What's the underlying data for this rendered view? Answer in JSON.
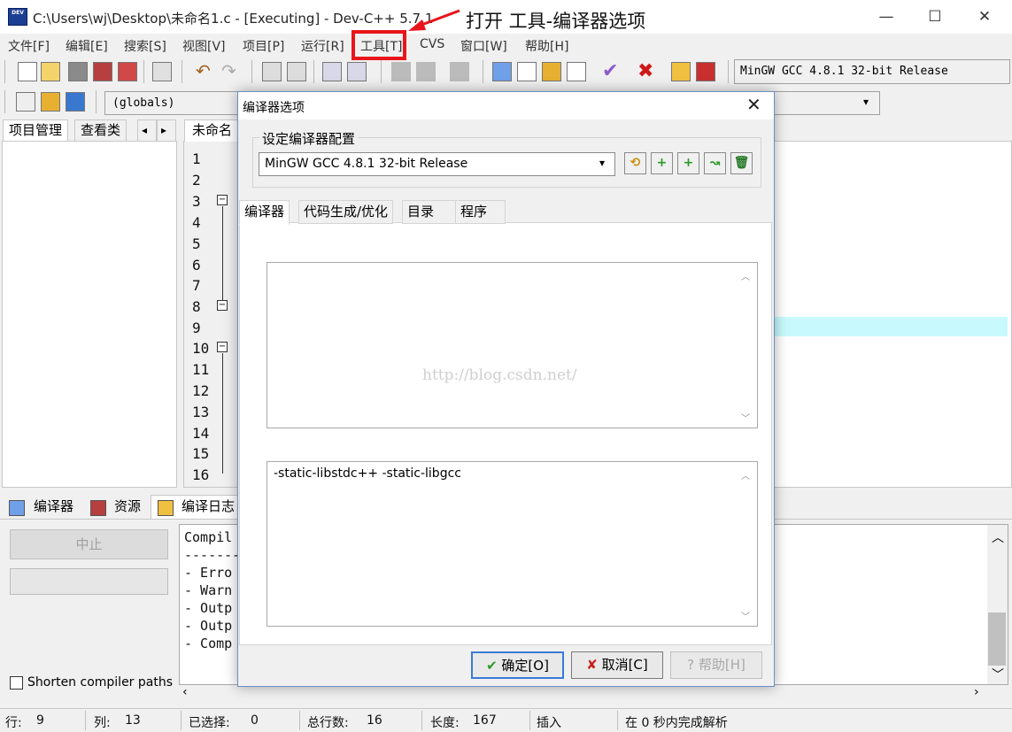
{
  "window": {
    "title": "C:\\Users\\wj\\Desktop\\未命名1.c - [Executing] - Dev-C++ 5.7.1",
    "app_icon_label": "DEV",
    "minimize": "—",
    "maximize": "☐",
    "close": "✕"
  },
  "annotation": {
    "text": "打开 工具-编译器选项",
    "color": "#e8151b"
  },
  "menu": [
    "文件[F]",
    "编辑[E]",
    "搜索[S]",
    "视图[V]",
    "项目[P]",
    "运行[R]",
    "工具[T]",
    "CVS",
    "窗口[W]",
    "帮助[H]"
  ],
  "toolbar": {
    "compiler_profile": "MinGW GCC 4.8.1 32-bit Release",
    "scope_select": "(globals)"
  },
  "left_panel": {
    "tabs": [
      "项目管理",
      "查看类"
    ],
    "nav_prev": "◂",
    "nav_next": "▸"
  },
  "editor": {
    "tab": "未命名1",
    "line_numbers": [
      "1",
      "2",
      "3",
      "4",
      "5",
      "6",
      "7",
      "8",
      "9",
      "10",
      "11",
      "12",
      "13",
      "14",
      "15",
      "16"
    ],
    "fold_open": "⊟"
  },
  "bottom_panel": {
    "tabs": [
      "编译器",
      "资源",
      "编译日志"
    ],
    "stop_button": "中止",
    "shorten_paths": "Shorten compiler paths",
    "shorten_paths_checked": false,
    "log_lines": [
      "Compil",
      "-------",
      "- Erro",
      "- Warn",
      "- Outp",
      "- Outp",
      "- Comp"
    ]
  },
  "statusbar": {
    "row_label": "行:",
    "row_value": "9",
    "col_label": "列:",
    "col_value": "13",
    "sel_label": "已选择:",
    "sel_value": "0",
    "lines_label": "总行数:",
    "lines_value": "16",
    "len_label": "长度:",
    "len_value": "167",
    "mode": "插入",
    "parse": "在 0 秒内完成解析"
  },
  "dialog": {
    "title": "编译器选项",
    "close": "✕",
    "group_label": "设定编译器配置",
    "profile": "MinGW GCC 4.8.1 32-bit Release",
    "tabs": [
      "编译器",
      "代码生成/优化",
      "目录",
      "程序"
    ],
    "active_tab": "编译器",
    "memo_top": "",
    "memo_bottom": "-static-libstdc++ -static-libgcc",
    "watermark": "http://blog.csdn.net/",
    "ok": "确定[O]",
    "cancel": "取消[C]",
    "help": "帮助[H]"
  }
}
